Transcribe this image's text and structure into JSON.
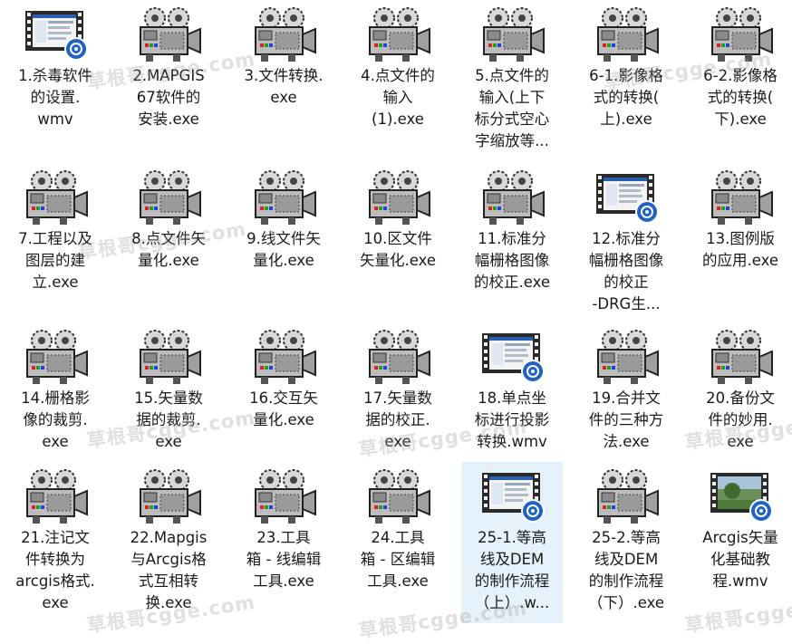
{
  "files": [
    {
      "lines": [
        "1.杀毒软件",
        "的设置.",
        "wmv"
      ],
      "type": "video"
    },
    {
      "lines": [
        "2.MAPGIS",
        "67软件的",
        "安装.exe"
      ],
      "type": "exe"
    },
    {
      "lines": [
        "3.文件转换.",
        "exe"
      ],
      "type": "exe"
    },
    {
      "lines": [
        "4.点文件的",
        "输入",
        "(1).exe"
      ],
      "type": "exe"
    },
    {
      "lines": [
        "5.点文件的",
        "输入(上下",
        "标分式空心",
        "字缩放等..."
      ],
      "type": "exe"
    },
    {
      "lines": [
        "6-1.影像格",
        "式的转换(",
        "上).exe"
      ],
      "type": "exe"
    },
    {
      "lines": [
        "6-2.影像格",
        "式的转换(",
        "下).exe"
      ],
      "type": "exe"
    },
    {
      "lines": [
        "7.工程以及",
        "图层的建",
        "立.exe"
      ],
      "type": "exe"
    },
    {
      "lines": [
        "8.点文件矢",
        "量化.exe"
      ],
      "type": "exe"
    },
    {
      "lines": [
        "9.线文件矢",
        "量化.exe"
      ],
      "type": "exe"
    },
    {
      "lines": [
        "10.区文件",
        "矢量化.exe"
      ],
      "type": "exe"
    },
    {
      "lines": [
        "11.标准分",
        "幅栅格图像",
        "的校正.exe"
      ],
      "type": "exe"
    },
    {
      "lines": [
        "12.标准分",
        "幅栅格图像",
        "的校正",
        "-DRG生..."
      ],
      "type": "video"
    },
    {
      "lines": [
        "13.图例版",
        "的应用.exe"
      ],
      "type": "exe"
    },
    {
      "lines": [
        "14.栅格影",
        "像的裁剪.",
        "exe"
      ],
      "type": "exe"
    },
    {
      "lines": [
        "15.矢量数",
        "据的裁剪.",
        "exe"
      ],
      "type": "exe"
    },
    {
      "lines": [
        "16.交互矢",
        "量化.exe"
      ],
      "type": "exe"
    },
    {
      "lines": [
        "17.矢量数",
        "据的校正.",
        "exe"
      ],
      "type": "exe"
    },
    {
      "lines": [
        "18.单点坐",
        "标进行投影",
        "转换.wmv"
      ],
      "type": "video"
    },
    {
      "lines": [
        "19.合并文",
        "件的三种方",
        "法.exe"
      ],
      "type": "exe"
    },
    {
      "lines": [
        "20.备份文",
        "件的妙用.",
        "exe"
      ],
      "type": "exe"
    },
    {
      "lines": [
        "21.注记文",
        "件转换为",
        "arcgis格式.",
        "exe"
      ],
      "type": "exe"
    },
    {
      "lines": [
        "22.Mapgis",
        "与Arcgis格",
        "式互相转",
        "换.exe"
      ],
      "type": "exe"
    },
    {
      "lines": [
        "23.工具",
        "箱 - 线编辑",
        "工具.exe"
      ],
      "type": "exe"
    },
    {
      "lines": [
        "24.工具",
        "箱 - 区编辑",
        "工具.exe"
      ],
      "type": "exe"
    },
    {
      "lines": [
        "25-1.等高",
        "线及DEM",
        "的制作流程",
        "（上）.w..."
      ],
      "type": "video",
      "selected": true
    },
    {
      "lines": [
        "25-2.等高",
        "线及DEM",
        "的制作流程",
        "（下）.exe"
      ],
      "type": "exe"
    },
    {
      "lines": [
        "Arcgis矢量",
        "化基础教",
        "程.wmv"
      ],
      "type": "photo"
    }
  ],
  "watermark": "草根哥cgge.com",
  "colors": {
    "selection": "#e5f1fb",
    "text": "#1a1a1a",
    "wmp_badge": "#1f63c6"
  }
}
